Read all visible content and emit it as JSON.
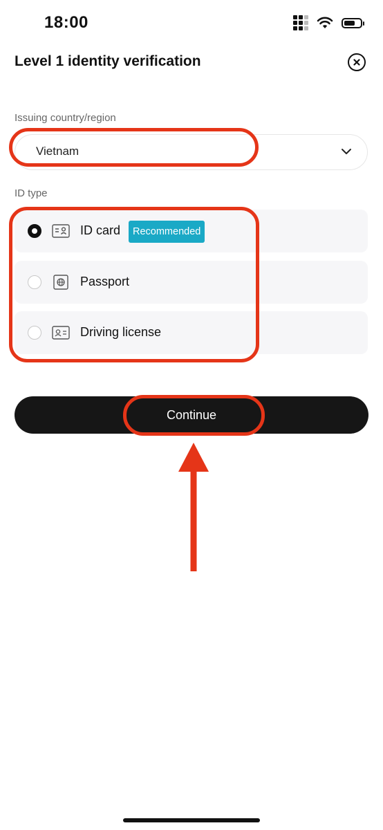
{
  "status_bar": {
    "time": "18:00",
    "battery_level": 0.7
  },
  "header": {
    "title": "Level 1 identity verification",
    "close_icon": "close-circle-icon"
  },
  "country": {
    "label": "Issuing country/region",
    "value": "Vietnam",
    "chevron_icon": "chevron-down-icon"
  },
  "id_type": {
    "label": "ID type",
    "options": [
      {
        "label": "ID card",
        "badge": "Recommended",
        "selected": true,
        "icon": "id-card-icon"
      },
      {
        "label": "Passport",
        "selected": false,
        "icon": "passport-icon"
      },
      {
        "label": "Driving license",
        "selected": false,
        "icon": "driving-license-icon"
      }
    ]
  },
  "actions": {
    "continue_label": "Continue"
  },
  "colors": {
    "badge": "#1aa9c6",
    "annotation": "#e53518",
    "button": "#161616"
  }
}
